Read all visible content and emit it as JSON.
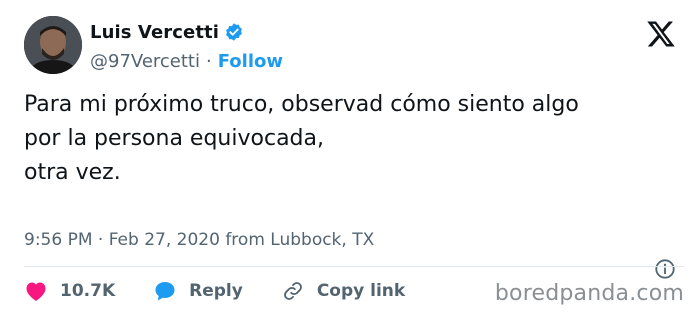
{
  "author": {
    "name": "Luis Vercetti",
    "handle": "@97Vercetti",
    "separator": "·",
    "follow_label": "Follow"
  },
  "tweet": {
    "lines": [
      "Para mi próximo truco, observad cómo siento algo",
      "por la persona equivocada,",
      "",
      "otra vez."
    ],
    "timestamp": "9:56 PM · Feb 27, 2020 from Lubbock, TX"
  },
  "actions": {
    "likes": "10.7K",
    "reply_label": "Reply",
    "copy_link_label": "Copy link"
  },
  "watermark": "boredpanda.com",
  "colors": {
    "accent": "#1d9bf0",
    "like": "#f91880",
    "text": "#0f1419",
    "muted": "#536471"
  },
  "icons": {
    "verified": "verified-badge-icon",
    "logo": "x-logo-icon",
    "info": "info-icon",
    "like": "heart-icon",
    "reply": "speech-bubble-icon",
    "copy": "link-icon"
  }
}
